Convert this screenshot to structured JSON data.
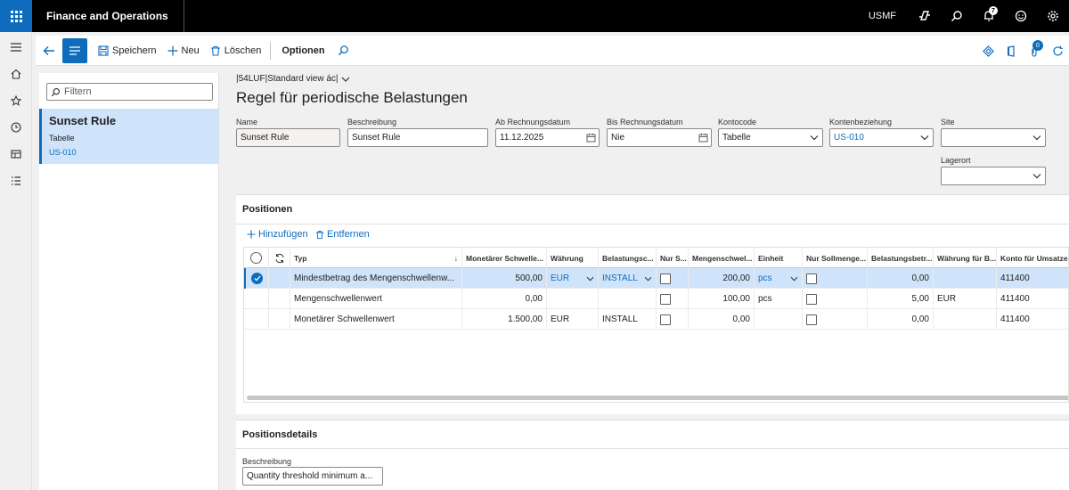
{
  "header": {
    "app_title": "Finance and Operations",
    "company": "USMF",
    "notification_count": "7"
  },
  "actions": {
    "save": "Speichern",
    "new": "Neu",
    "delete": "Löschen",
    "options": "Optionen",
    "attachments_count": "0"
  },
  "listpanel": {
    "filter_placeholder": "Filtern",
    "item": {
      "title": "Sunset Rule",
      "subtitle": "Tabelle",
      "code": "US-010"
    }
  },
  "view_selector": "|54LUF|Standard view ác|",
  "page_title": "Regel für periodische Belastungen",
  "fields": {
    "name": {
      "label": "Name",
      "value": "Sunset Rule"
    },
    "description": {
      "label": "Beschreibung",
      "value": "Sunset Rule"
    },
    "from_date": {
      "label": "Ab Rechnungsdatum",
      "value": "11.12.2025"
    },
    "to_date": {
      "label": "Bis Rechnungsdatum",
      "value": "Nie"
    },
    "account_code": {
      "label": "Kontocode",
      "value": "Tabelle"
    },
    "account_relation": {
      "label": "Kontenbeziehung",
      "value": "US-010"
    },
    "site": {
      "label": "Site",
      "value": ""
    },
    "warehouse": {
      "label": "Lagerort",
      "value": ""
    }
  },
  "positions": {
    "title": "Positionen",
    "add": "Hinzufügen",
    "remove": "Entfernen",
    "columns": [
      "Typ",
      "Monetärer Schwelle...",
      "Währung",
      "Belastungsc...",
      "Nur S...",
      "Mengenschwel...",
      "Einheit",
      "Nur Sollmenge...",
      "Belastungsbetr...",
      "Währung für B...",
      "Konto für Umsatzerl..."
    ],
    "rows": [
      {
        "type": "Mindestbetrag des Mengenschwellenw...",
        "mon_threshold": "500,00",
        "currency": "EUR",
        "charge_code": "INSTALL",
        "qty_threshold": "200,00",
        "unit": "pcs",
        "charge_amount": "0,00",
        "charge_currency": "",
        "revenue_account": "411400"
      },
      {
        "type": "Mengenschwellenwert",
        "mon_threshold": "0,00",
        "currency": "",
        "charge_code": "",
        "qty_threshold": "100,00",
        "unit": "pcs",
        "charge_amount": "5,00",
        "charge_currency": "EUR",
        "revenue_account": "411400"
      },
      {
        "type": "Monetärer Schwellenwert",
        "mon_threshold": "1.500,00",
        "currency": "EUR",
        "charge_code": "INSTALL",
        "qty_threshold": "0,00",
        "unit": "",
        "charge_amount": "0,00",
        "charge_currency": "",
        "revenue_account": "411400"
      }
    ]
  },
  "details": {
    "title": "Positionsdetails",
    "desc_label": "Beschreibung",
    "desc_value": "Quantity threshold minimum a..."
  }
}
